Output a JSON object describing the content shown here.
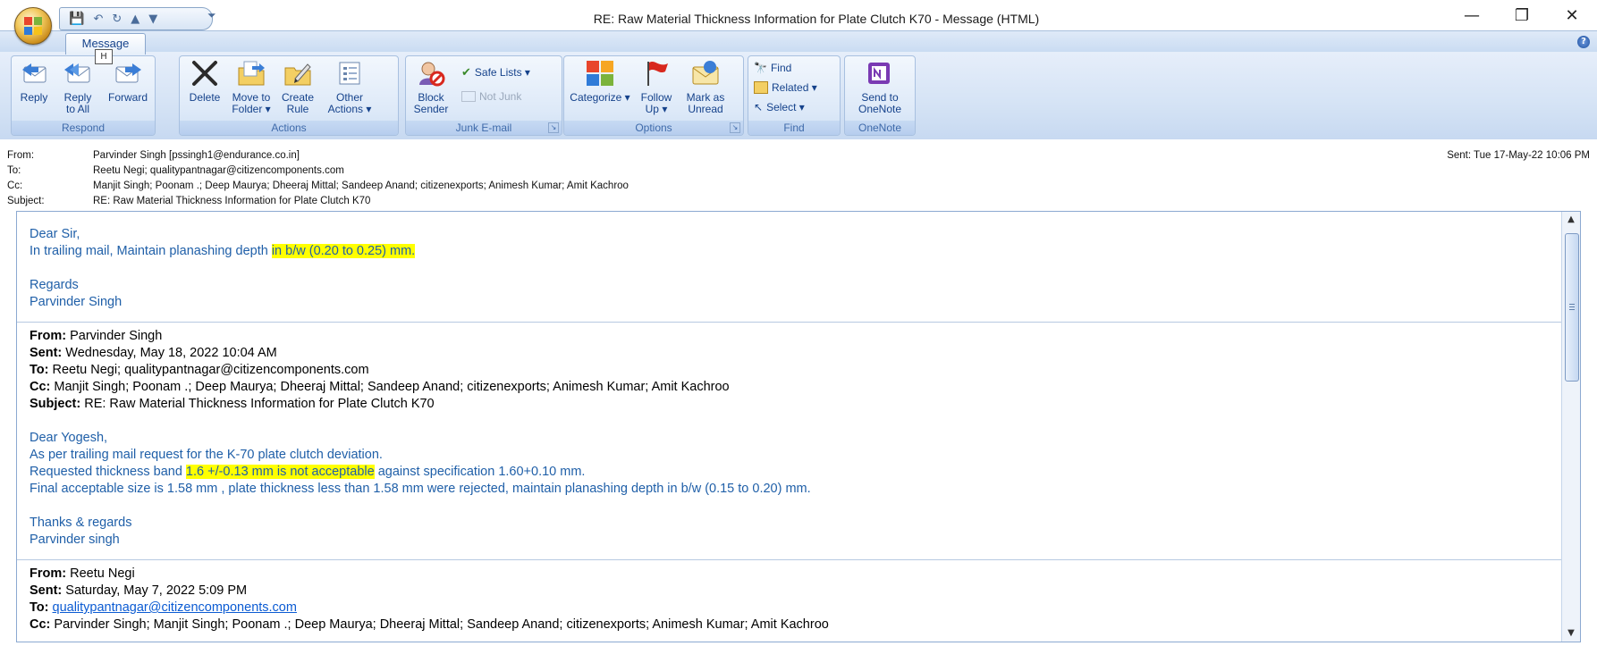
{
  "window": {
    "title": "RE: Raw Material Thickness Information for Plate Clutch K70 - Message (HTML)",
    "controls": [
      "minimize-icon",
      "restore-icon",
      "close-icon"
    ]
  },
  "qat": {
    "more": "⏷"
  },
  "ribbon": {
    "tab": "Message",
    "keytip": "H",
    "groups": {
      "respond": {
        "name": "Respond",
        "reply": "Reply",
        "reply_all": "Reply to All",
        "forward": "Forward"
      },
      "actions": {
        "name": "Actions",
        "delete": "Delete",
        "move": "Move to Folder ▾",
        "create_rule": "Create Rule",
        "other": "Other Actions ▾"
      },
      "junk": {
        "name": "Junk E-mail",
        "block": "Block Sender",
        "safe_lists": "Safe Lists ▾",
        "not_junk": "Not Junk"
      },
      "options": {
        "name": "Options",
        "categorize": "Categorize ▾",
        "follow_up": "Follow Up ▾",
        "mark_unread": "Mark as Unread"
      },
      "find": {
        "name": "Find",
        "find": "Find",
        "related": "Related ▾",
        "select": "Select ▾"
      },
      "onenote": {
        "name": "OneNote",
        "send": "Send to OneNote"
      }
    }
  },
  "header": {
    "from_label": "From:",
    "from": "Parvinder Singh [pssingh1@endurance.co.in]",
    "to_label": "To:",
    "to": "Reetu Negi; qualitypantnagar@citizencomponents.com",
    "cc_label": "Cc:",
    "cc": "Manjit Singh; Poonam .; Deep Maurya; Dheeraj Mittal; Sandeep Anand; citizenexports; Animesh Kumar; Amit Kachroo",
    "subject_label": "Subject:",
    "subject": "RE: Raw Material Thickness Information for Plate Clutch K70",
    "sent": "Sent:   Tue 17-May-22 10:06 PM"
  },
  "body": {
    "m1": {
      "greeting": "Dear Sir,",
      "line1_pre": "In trailing mail, Maintain  planashing depth ",
      "line1_hl": "in b/w (0.20 to 0.25) mm.",
      "regards": "Regards",
      "name": "Parvinder Singh"
    },
    "q1": {
      "from_l": "From:",
      "from": " Parvinder Singh",
      "sent_l": "Sent:",
      "sent": " Wednesday, May 18, 2022 10:04 AM",
      "to_l": "To:",
      "to": " Reetu Negi; qualitypantnagar@citizencomponents.com",
      "cc_l": "Cc:",
      "cc": " Manjit Singh; Poonam .; Deep Maurya; Dheeraj Mittal; Sandeep Anand; citizenexports; Animesh Kumar; Amit Kachroo",
      "subject_l": "Subject:",
      "subject": " RE: Raw Material Thickness Information for Plate Clutch K70",
      "greeting": "Dear Yogesh,",
      "l1": "As per trailing mail request for the K-70 plate clutch deviation.",
      "l2_pre": "Requested thickness band ",
      "l2_hl": "1.6 +/-0.13 mm is not acceptable",
      "l2_post": " against specification 1.60+0.10 mm.",
      "l3": "Final acceptable size is 1.58 mm , plate thickness less than  1.58 mm were rejected, maintain planashing depth in b/w (0.15 to 0.20) mm.",
      "thanks": "Thanks & regards",
      "name": "Parvinder singh"
    },
    "q2": {
      "from_l": "From:",
      "from": " Reetu Negi",
      "sent_l": "Sent:",
      "sent": " Saturday, May 7, 2022 5:09 PM",
      "to_l": "To:",
      "to": "qualitypantnagar@citizencomponents.com",
      "cc_l": "Cc:",
      "cc": " Parvinder Singh; Manjit Singh; Poonam .; Deep Maurya; Dheeraj Mittal; Sandeep Anand; citizenexports; Animesh Kumar; Amit Kachroo"
    }
  },
  "colors": {
    "ribbon_text": "#15428b",
    "body_blue": "#1f5fa8",
    "highlight": "#ffff00"
  }
}
